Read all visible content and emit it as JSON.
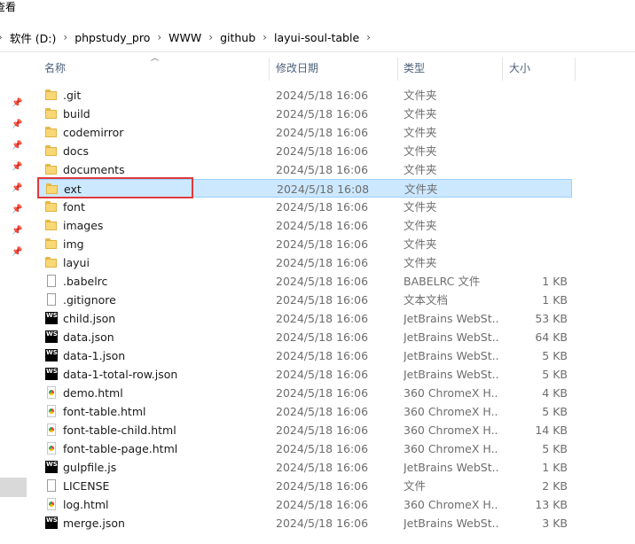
{
  "top_strip_text": "查看",
  "breadcrumb": [
    "软件 (D:)",
    "phpstudy_pro",
    "WWW",
    "github",
    "layui-soul-table"
  ],
  "columns": {
    "name": "名称",
    "date": "修改日期",
    "type": "类型",
    "size": "大小"
  },
  "files": [
    {
      "name": ".git",
      "date": "2024/5/18 16:06",
      "type": "文件夹",
      "size": "",
      "icon": "folder-icon"
    },
    {
      "name": "build",
      "date": "2024/5/18 16:06",
      "type": "文件夹",
      "size": "",
      "icon": "folder-icon"
    },
    {
      "name": "codemirror",
      "date": "2024/5/18 16:06",
      "type": "文件夹",
      "size": "",
      "icon": "folder-icon"
    },
    {
      "name": "docs",
      "date": "2024/5/18 16:06",
      "type": "文件夹",
      "size": "",
      "icon": "folder-icon"
    },
    {
      "name": "documents",
      "date": "2024/5/18 16:06",
      "type": "文件夹",
      "size": "",
      "icon": "folder-icon"
    },
    {
      "name": "ext",
      "date": "2024/5/18 16:08",
      "type": "文件夹",
      "size": "",
      "icon": "folder-icon",
      "selected": true
    },
    {
      "name": "font",
      "date": "2024/5/18 16:06",
      "type": "文件夹",
      "size": "",
      "icon": "folder-icon"
    },
    {
      "name": "images",
      "date": "2024/5/18 16:06",
      "type": "文件夹",
      "size": "",
      "icon": "folder-icon"
    },
    {
      "name": "img",
      "date": "2024/5/18 16:06",
      "type": "文件夹",
      "size": "",
      "icon": "folder-icon"
    },
    {
      "name": "layui",
      "date": "2024/5/18 16:06",
      "type": "文件夹",
      "size": "",
      "icon": "folder-icon"
    },
    {
      "name": ".babelrc",
      "date": "2024/5/18 16:06",
      "type": "BABELRC 文件",
      "size": "1 KB",
      "icon": "file-icon"
    },
    {
      "name": ".gitignore",
      "date": "2024/5/18 16:06",
      "type": "文本文档",
      "size": "1 KB",
      "icon": "file-icon"
    },
    {
      "name": "child.json",
      "date": "2024/5/18 16:06",
      "type": "JetBrains WebSt...",
      "size": "53 KB",
      "icon": "webstorm-icon"
    },
    {
      "name": "data.json",
      "date": "2024/5/18 16:06",
      "type": "JetBrains WebSt...",
      "size": "64 KB",
      "icon": "webstorm-icon"
    },
    {
      "name": "data-1.json",
      "date": "2024/5/18 16:06",
      "type": "JetBrains WebSt...",
      "size": "5 KB",
      "icon": "webstorm-icon"
    },
    {
      "name": "data-1-total-row.json",
      "date": "2024/5/18 16:06",
      "type": "JetBrains WebSt...",
      "size": "5 KB",
      "icon": "webstorm-icon"
    },
    {
      "name": "demo.html",
      "date": "2024/5/18 16:06",
      "type": "360 ChromeX H...",
      "size": "4 KB",
      "icon": "chrome-html-icon"
    },
    {
      "name": "font-table.html",
      "date": "2024/5/18 16:06",
      "type": "360 ChromeX H...",
      "size": "5 KB",
      "icon": "chrome-html-icon"
    },
    {
      "name": "font-table-child.html",
      "date": "2024/5/18 16:06",
      "type": "360 ChromeX H...",
      "size": "14 KB",
      "icon": "chrome-html-icon"
    },
    {
      "name": "font-table-page.html",
      "date": "2024/5/18 16:06",
      "type": "360 ChromeX H...",
      "size": "5 KB",
      "icon": "chrome-html-icon"
    },
    {
      "name": "gulpfile.js",
      "date": "2024/5/18 16:06",
      "type": "JetBrains WebSt...",
      "size": "1 KB",
      "icon": "webstorm-icon"
    },
    {
      "name": "LICENSE",
      "date": "2024/5/18 16:06",
      "type": "文件",
      "size": "2 KB",
      "icon": "file-icon"
    },
    {
      "name": "log.html",
      "date": "2024/5/18 16:06",
      "type": "360 ChromeX H...",
      "size": "13 KB",
      "icon": "chrome-html-icon"
    },
    {
      "name": "merge.json",
      "date": "2024/5/18 16:06",
      "type": "JetBrains WebSt...",
      "size": "3 KB",
      "icon": "webstorm-icon"
    }
  ],
  "colors": {
    "selection_bg": "#cce8ff",
    "selection_border": "#99d1ff",
    "highlight_box": "#e0393e",
    "pin": "#5a7fb0"
  }
}
